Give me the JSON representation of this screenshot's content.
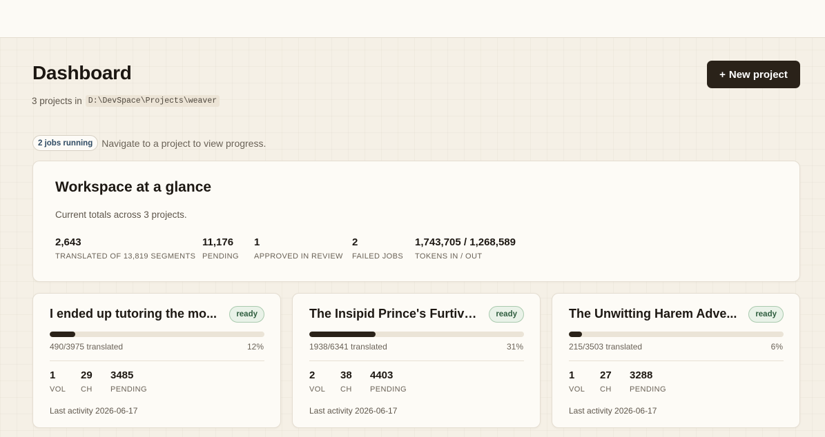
{
  "header": {
    "title": "Dashboard",
    "new_project_icon": "+",
    "new_project_label": "New project",
    "subtitle_prefix": "3 projects in",
    "path": "D:\\DevSpace\\Projects\\weaver"
  },
  "jobs": {
    "badge": "2 jobs running",
    "message": "Navigate to a project to view progress."
  },
  "workspace": {
    "title": "Workspace at a glance",
    "subtitle": "Current totals across 3 projects.",
    "stats": [
      {
        "value": "2,643",
        "label": "Translated of 13,819 segments"
      },
      {
        "value": "11,176",
        "label": "Pending"
      },
      {
        "value": "1",
        "label": "Approved in review"
      },
      {
        "value": "2",
        "label": "Failed jobs"
      },
      {
        "value": "1,743,705 / 1,268,589",
        "label": "Tokens in / out"
      }
    ]
  },
  "projects": [
    {
      "title": "I ended up tutoring the mo...",
      "status": "ready",
      "progress_fraction": 0.12,
      "progress_text": "490/3975 translated",
      "percent": "12%",
      "vol": "1",
      "vol_label": "Vol",
      "ch": "29",
      "ch_label": "Ch",
      "pending": "3485",
      "pending_label": "Pending",
      "last_activity": "Last activity 2026-06-17"
    },
    {
      "title": "The Insipid Prince's Furtive ...",
      "status": "ready",
      "progress_fraction": 0.31,
      "progress_text": "1938/6341 translated",
      "percent": "31%",
      "vol": "2",
      "vol_label": "Vol",
      "ch": "38",
      "ch_label": "Ch",
      "pending": "4403",
      "pending_label": "Pending",
      "last_activity": "Last activity 2026-06-17"
    },
    {
      "title": "The Unwitting Harem Adve...",
      "status": "ready",
      "progress_fraction": 0.06,
      "progress_text": "215/3503 translated",
      "percent": "6%",
      "vol": "1",
      "vol_label": "Vol",
      "ch": "27",
      "ch_label": "Ch",
      "pending": "3288",
      "pending_label": "Pending",
      "last_activity": "Last activity 2026-06-17"
    }
  ]
}
